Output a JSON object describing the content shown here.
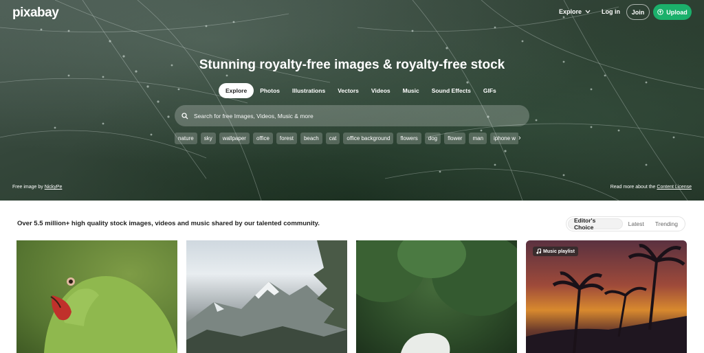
{
  "header": {
    "logo": "pixabay",
    "explore": "Explore",
    "login": "Log in",
    "join": "Join",
    "upload": "Upload"
  },
  "hero": {
    "headline": "Stunning royalty-free images & royalty-free stock",
    "tabs": [
      "Explore",
      "Photos",
      "Illustrations",
      "Vectors",
      "Videos",
      "Music",
      "Sound Effects",
      "GIFs"
    ],
    "search_placeholder": "Search for free Images, Videos, Music & more",
    "chips": [
      "nature",
      "sky",
      "wallpaper",
      "office",
      "forest",
      "beach",
      "cat",
      "office background",
      "flowers",
      "dog",
      "flower",
      "man",
      "iphone w"
    ],
    "credit_prefix": "Free image by ",
    "credit_user": "NickyPe",
    "license_prefix": "Read more about the ",
    "license_link": "Content License"
  },
  "main": {
    "subtitle": "Over 5.5 million+ high quality stock images, videos and music shared by our talented community.",
    "sort": [
      "Editor's Choice",
      "Latest",
      "Trending"
    ],
    "cards": [
      {
        "subject": "parrot"
      },
      {
        "subject": "mountain"
      },
      {
        "subject": "forest"
      },
      {
        "subject": "palm-sunset",
        "badge": "Music playlist"
      }
    ]
  },
  "colors": {
    "accent": "#1bb06b",
    "text": "#222222"
  }
}
